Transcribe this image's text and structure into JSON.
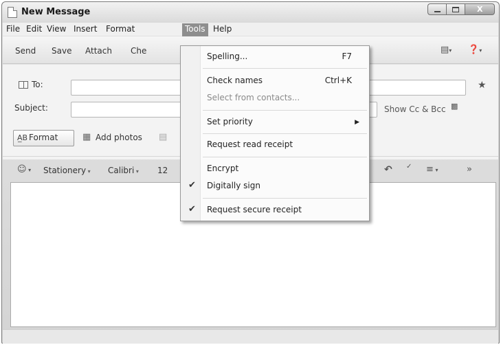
{
  "window": {
    "title": "New Message",
    "minimize_label": "",
    "close_glyph": "X"
  },
  "menubar": {
    "items": [
      "File",
      "Edit",
      "View",
      "Insert",
      "Format",
      "Tools",
      "Help"
    ],
    "active": "Tools"
  },
  "toolbar": {
    "send": "Send",
    "save": "Save",
    "attach": "Attach",
    "check_partial": "Che",
    "right_icons": [
      "print-preview-icon",
      "help-icon"
    ]
  },
  "headers": {
    "to_label": "To:",
    "subject_label": "Subject:",
    "show_cc_bcc": "Show Cc & Bcc",
    "to_value": "",
    "subject_value": ""
  },
  "format_bar": {
    "format_label": "Format",
    "add_photos": "Add photos"
  },
  "style_bar": {
    "stationery": "Stationery",
    "font": "Calibri",
    "size": "12"
  },
  "tools_menu": {
    "items": [
      {
        "label": "Spelling...",
        "shortcut": "F7",
        "checked": false,
        "disabled": false
      },
      {
        "label": "Check names",
        "shortcut": "Ctrl+K",
        "checked": false,
        "disabled": false
      },
      {
        "label": "Select from contacts...",
        "shortcut": "",
        "checked": false,
        "disabled": true
      },
      {
        "label": "Set priority",
        "shortcut": "",
        "checked": false,
        "disabled": false,
        "submenu": true
      },
      {
        "label": "Request read receipt",
        "shortcut": "",
        "checked": false,
        "disabled": false
      },
      {
        "label": "Encrypt",
        "shortcut": "",
        "checked": false,
        "disabled": false
      },
      {
        "label": "Digitally sign",
        "shortcut": "",
        "checked": true,
        "disabled": false
      },
      {
        "label": "Request secure receipt",
        "shortcut": "",
        "checked": true,
        "disabled": false
      }
    ]
  }
}
